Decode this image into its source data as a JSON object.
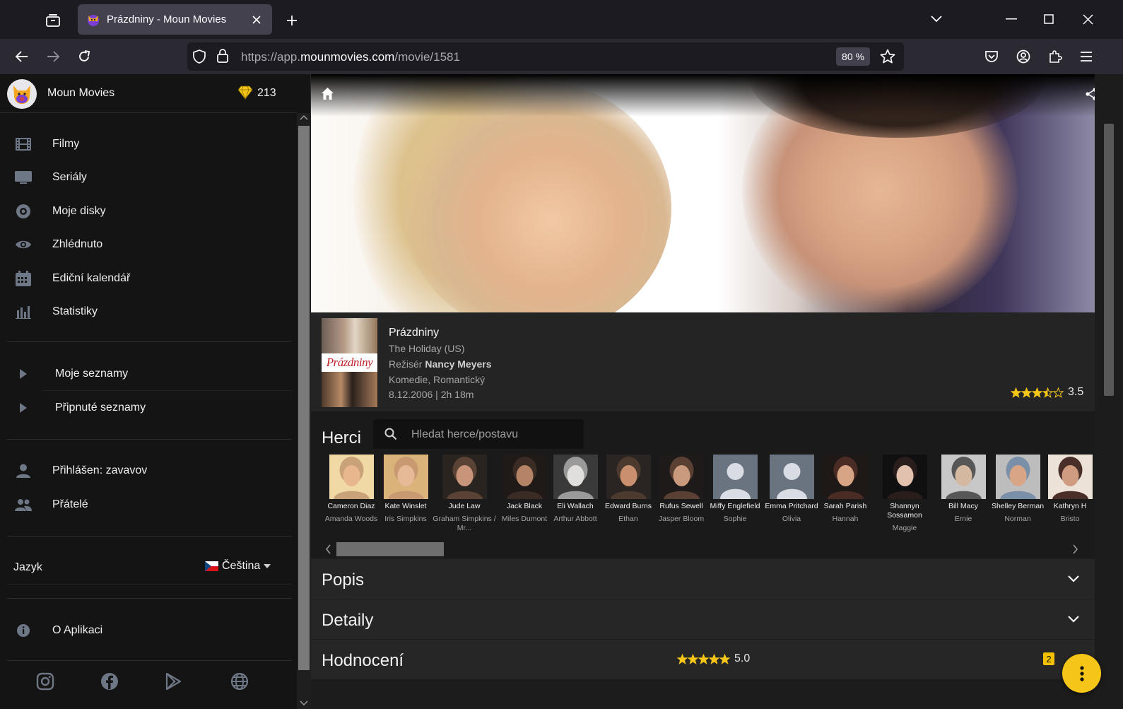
{
  "browser": {
    "tab_title": "Prázdniny - Moun Movies",
    "url_base": "https://app.",
    "url_domain": "mounmovies.com",
    "url_path": "/movie/1581",
    "zoom": "80 %"
  },
  "sidebar": {
    "app_name": "Moun Movies",
    "gem_count": "213",
    "menu": [
      {
        "label": "Filmy",
        "icon": "film-icon"
      },
      {
        "label": "Seriály",
        "icon": "tv-icon"
      },
      {
        "label": "Moje disky",
        "icon": "disc-icon"
      },
      {
        "label": "Zhlédnuto",
        "icon": "eye-icon"
      },
      {
        "label": "Ediční kalendář",
        "icon": "calendar-icon"
      },
      {
        "label": "Statistiky",
        "icon": "bar-chart-icon"
      }
    ],
    "lists": [
      {
        "label": "Moje seznamy",
        "icon": "triangle-right-icon"
      },
      {
        "label": "Připnuté seznamy",
        "icon": "triangle-right-icon"
      }
    ],
    "user": {
      "label": "Přihlášen: zavavov",
      "icon": "person-icon"
    },
    "friends": {
      "label": "Přátelé",
      "icon": "people-icon"
    },
    "language_label": "Jazyk",
    "language_value": "Čeština",
    "about": "O Aplikaci"
  },
  "movie": {
    "title": "Prázdniny",
    "original_title": "The Holiday (US)",
    "director_prefix": "Režisér",
    "director": "Nancy Meyers",
    "genres": "Komedie, Romantický",
    "release": "8.12.2006 | 2h 18m",
    "poster_title": "Prázdniny",
    "rating": 3.5,
    "rating_text": "3.5"
  },
  "cast": {
    "title": "Herci",
    "search_placeholder": "Hledat herce/postavu",
    "actors": [
      {
        "name": "Cameron Diaz",
        "role": "Amanda Woods"
      },
      {
        "name": "Kate Winslet",
        "role": "Iris Simpkins"
      },
      {
        "name": "Jude Law",
        "role": "Graham Simpkins / Mr..."
      },
      {
        "name": "Jack Black",
        "role": "Miles Dumont"
      },
      {
        "name": "Eli Wallach",
        "role": "Arthur Abbott"
      },
      {
        "name": "Edward Burns",
        "role": "Ethan"
      },
      {
        "name": "Rufus Sewell",
        "role": "Jasper Bloom"
      },
      {
        "name": "Miffy Englefield",
        "role": "Sophie"
      },
      {
        "name": "Emma Pritchard",
        "role": "Olivia"
      },
      {
        "name": "Sarah Parish",
        "role": "Hannah"
      },
      {
        "name": "Shannyn Sossamon",
        "role": "Maggie"
      },
      {
        "name": "Bill Macy",
        "role": "Ernie"
      },
      {
        "name": "Shelley Berman",
        "role": "Norman"
      },
      {
        "name": "Kathryn H",
        "role": "Bristo"
      }
    ]
  },
  "sections": {
    "description": "Popis",
    "details": "Detaily",
    "ratings": "Hodnocení",
    "ratings_score": 5.0,
    "ratings_score_text": "5.0",
    "ratings_count": "2"
  },
  "colors": {
    "accent": "#f5c518",
    "star": "#f5c518"
  }
}
